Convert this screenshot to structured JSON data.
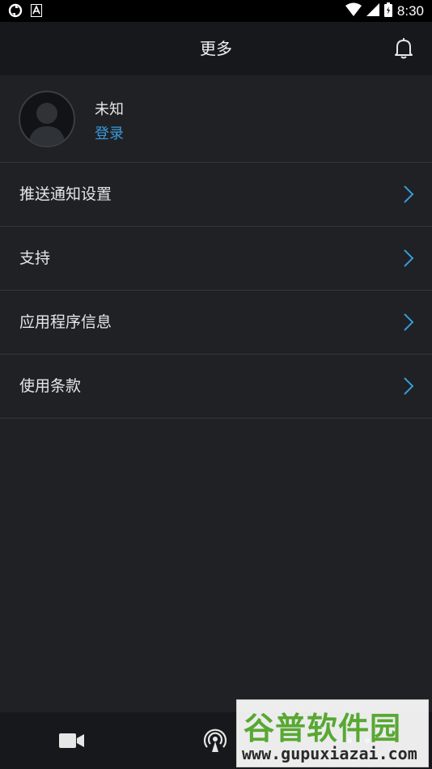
{
  "status_bar": {
    "time": "8:30"
  },
  "header": {
    "title": "更多"
  },
  "profile": {
    "name": "未知",
    "login_label": "登录"
  },
  "menu": {
    "items": [
      {
        "label": "推送通知设置"
      },
      {
        "label": "支持"
      },
      {
        "label": "应用程序信息"
      },
      {
        "label": "使用条款"
      }
    ]
  },
  "bottom_nav": {
    "tabs": [
      "video-camera-icon",
      "broadcast-icon",
      "more-icon"
    ]
  },
  "watermark": {
    "text_cn": "谷普软件园",
    "url": "www.gupuxiazai.com"
  },
  "colors": {
    "accent": "#3a9bdc",
    "background": "#1f2125",
    "header": "#16181c"
  }
}
